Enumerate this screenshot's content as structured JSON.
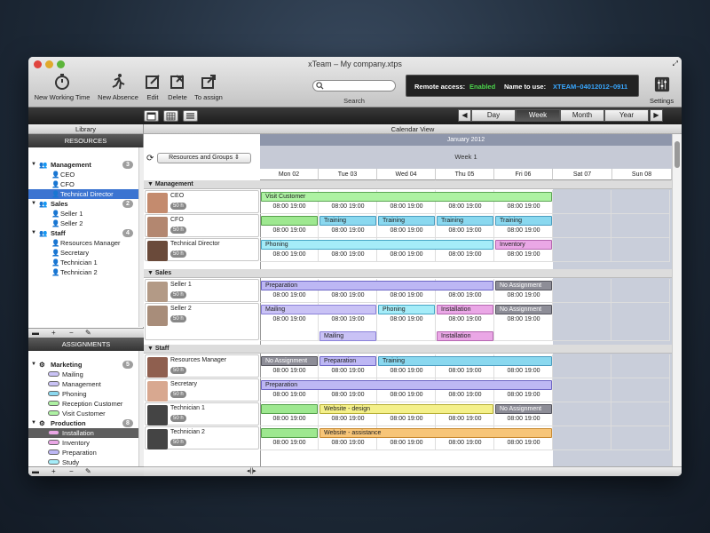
{
  "window": {
    "title": "xTeam – My company.xtps"
  },
  "toolbar": {
    "new_working_time": "New Working Time",
    "new_absence": "New Absence",
    "edit": "Edit",
    "delete": "Delete",
    "to_assign": "To assign",
    "search_label": "Search",
    "settings": "Settings"
  },
  "remote": {
    "label": "Remote access:",
    "status": "Enabled",
    "name_label": "Name to use:",
    "name_value": "XTEAM–04012012–0911"
  },
  "period": {
    "day": "Day",
    "week": "Week",
    "month": "Month",
    "year": "Year"
  },
  "library": {
    "title": "Library",
    "resources_header": "RESOURCES",
    "assignments_header": "ASSIGNMENTS",
    "resources": [
      {
        "name": "Management",
        "count": "3",
        "items": [
          "CEO",
          "CFO",
          "Technical Director"
        ]
      },
      {
        "name": "Sales",
        "count": "2",
        "items": [
          "Seller 1",
          "Seller 2"
        ]
      },
      {
        "name": "Staff",
        "count": "4",
        "items": [
          "Resources Manager",
          "Secretary",
          "Technician 1",
          "Technician 2"
        ]
      }
    ],
    "assignments": [
      {
        "name": "Marketing",
        "count": "5",
        "items": [
          "Mailing",
          "Management",
          "Phoning",
          "Reception Customer",
          "Visit Customer"
        ]
      },
      {
        "name": "Production",
        "count": "8",
        "items": [
          "Installation",
          "Inventory",
          "Preparation",
          "Study"
        ]
      }
    ]
  },
  "calendar": {
    "title": "Calendar View",
    "month": "January 2012",
    "week": "Week 1",
    "group_by": "Resources and Groups",
    "days": [
      "Mon 02",
      "Tue 03",
      "Wed 04",
      "Thu 05",
      "Fri 06",
      "Sat 07",
      "Sun 08"
    ],
    "groups": {
      "management": "Management",
      "sales": "Sales",
      "staff": "Staff"
    },
    "people": {
      "ceo": "CEO",
      "cfo": "CFO",
      "td": "Technical Director",
      "s1": "Seller 1",
      "s2": "Seller 2",
      "rm": "Resources Manager",
      "sec": "Secretary",
      "t1": "Technician 1",
      "t2": "Technician 2"
    },
    "hours": "50 h",
    "time": "08:00 19:00",
    "events": {
      "visit_customer": "Visit Customer",
      "training": "Training",
      "phoning": "Phoning",
      "inventory": "Inventory",
      "preparation": "Preparation",
      "no_assignment": "No Assignment",
      "mailing": "Mailing",
      "installation": "Installation",
      "website_design": "Website - design",
      "website_assistance": "Website - assistance"
    }
  }
}
